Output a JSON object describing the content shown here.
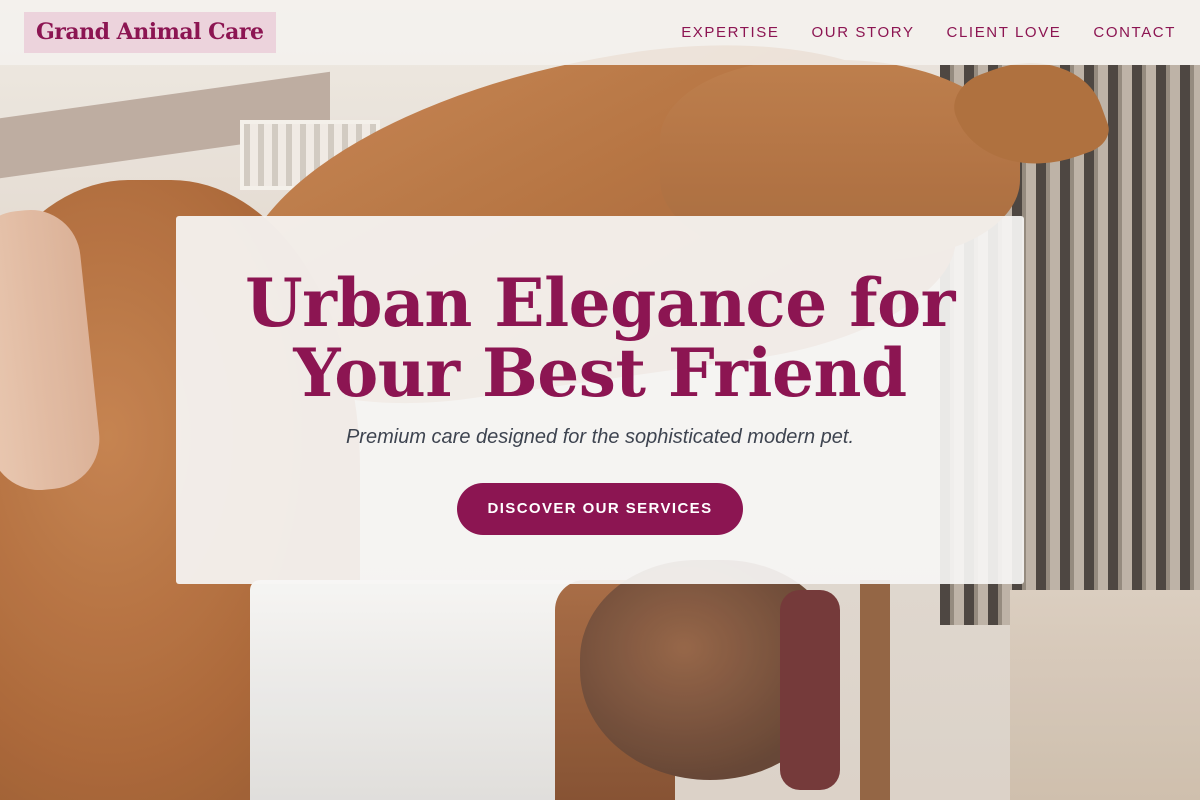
{
  "header": {
    "logo_text": "Grand Animal Care",
    "nav": [
      {
        "label": "EXPERTISE"
      },
      {
        "label": "OUR STORY"
      },
      {
        "label": "CLIENT LOVE"
      },
      {
        "label": "CONTACT"
      }
    ]
  },
  "hero": {
    "title_line1": "Urban Elegance for",
    "title_line2": "Your Best Friend",
    "subtitle": "Premium care designed for the sophisticated modern pet.",
    "cta_label": "DISCOVER OUR SERVICES"
  },
  "colors": {
    "brand": "#8c1552",
    "logo_bg": "#ecd3dc",
    "subtitle_text": "#3e4450",
    "card_bg": "#f6f5f4"
  }
}
